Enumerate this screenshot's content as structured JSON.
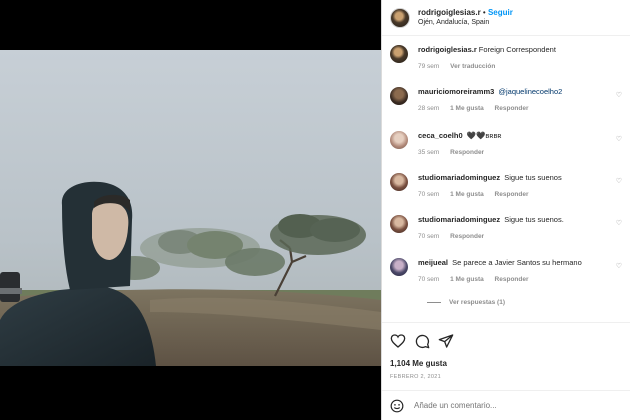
{
  "post": {
    "username": "rodrigoiglesias.r",
    "separator": "•",
    "follow_label": "Seguir",
    "location": "Ojén, Andalucía, Spain"
  },
  "comments": [
    {
      "user": "rodrigoiglesias.r",
      "text": "Foreign Correspondent",
      "time": "79 sem",
      "likes": "",
      "reply": "",
      "translate": "Ver traducción"
    },
    {
      "user": "mauriciomoreiramm3",
      "mention": "@jaquelinecoelho2",
      "text": "",
      "time": "28 sem",
      "likes": "1 Me gusta",
      "reply": "Responder"
    },
    {
      "user": "ceca_coelh0",
      "text": "🖤🖤ʙʀʙʀ",
      "time": "35 sem",
      "likes": "",
      "reply": "Responder"
    },
    {
      "user": "studiomariadominguez",
      "text": "Sigue tus suenos",
      "time": "70 sem",
      "likes": "1 Me gusta",
      "reply": "Responder"
    },
    {
      "user": "studiomariadominguez",
      "text": "Sigue tus suenos.",
      "time": "70 sem",
      "likes": "",
      "reply": "Responder"
    },
    {
      "user": "meijueal",
      "text": "Se parece a Javier Santos su hermano",
      "time": "70 sem",
      "likes": "1 Me gusta",
      "reply": "Responder"
    }
  ],
  "view_replies": "Ver respuestas (1)",
  "actions": {
    "likes": "1,104 Me gusta",
    "date": "FEBRERO 2, 2021"
  },
  "composer": {
    "placeholder": "Añade un comentario..."
  },
  "icons": {
    "like": "heart-icon",
    "comment": "comment-icon",
    "share": "share-icon",
    "emoji": "emoji-icon"
  }
}
